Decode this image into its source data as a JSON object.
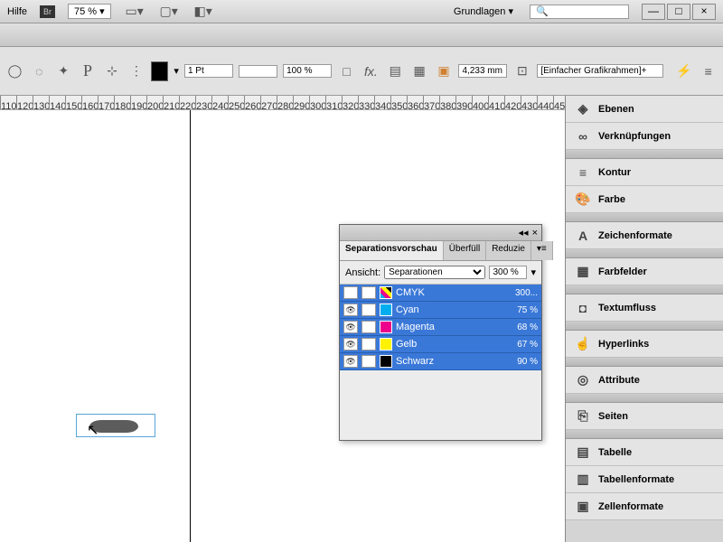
{
  "menubar": {
    "help": "Hilfe",
    "zoom": "75 %",
    "workspace": "Grundlagen",
    "search_placeholder": "🔍"
  },
  "controlbar": {
    "stroke": "1 Pt",
    "opacity": "100 %",
    "width": "4,233 mm",
    "frame_type": "[Einfacher Grafikrahmen]+"
  },
  "ruler_start": 110,
  "ruler_step": 10,
  "ruler_count": 35,
  "panels": [
    {
      "label": "Ebenen",
      "icon": "◈",
      "bold": true
    },
    {
      "label": "Verknüpfungen",
      "icon": "∞",
      "bold": true
    },
    {
      "divider": true
    },
    {
      "label": "Kontur",
      "icon": "≡",
      "bold": true
    },
    {
      "label": "Farbe",
      "icon": "🎨",
      "bold": true
    },
    {
      "divider": true
    },
    {
      "label": "Zeichenformate",
      "icon": "A",
      "bold": true
    },
    {
      "divider": true
    },
    {
      "label": "Farbfelder",
      "icon": "▦",
      "bold": true
    },
    {
      "divider": true
    },
    {
      "label": "Textumfluss",
      "icon": "◘",
      "bold": true
    },
    {
      "divider": true
    },
    {
      "label": "Hyperlinks",
      "icon": "☝",
      "bold": true
    },
    {
      "divider": true
    },
    {
      "label": "Attribute",
      "icon": "◎",
      "bold": true
    },
    {
      "divider": true
    },
    {
      "label": "Seiten",
      "icon": "⎘",
      "bold": true
    },
    {
      "divider": true
    },
    {
      "label": "Tabelle",
      "icon": "▤",
      "bold": true
    },
    {
      "label": "Tabellenformate",
      "icon": "▥",
      "bold": true
    },
    {
      "label": "Zellenformate",
      "icon": "▣",
      "bold": true
    }
  ],
  "sep_panel": {
    "tabs": [
      "Separationsvorschau",
      "Überfüll",
      "Reduzie"
    ],
    "ansicht_label": "Ansicht:",
    "ansicht_value": "Separationen",
    "limit": "300 %",
    "rows": [
      {
        "name": "CMYK",
        "value": "300...",
        "color": "linear-gradient(45deg,#00aeef 25%,#ec008c 25% 50%,#fff200 50% 75%,#000 75%)",
        "eye": false
      },
      {
        "name": "Cyan",
        "value": "75 %",
        "color": "#00aeef",
        "eye": true
      },
      {
        "name": "Magenta",
        "value": "68 %",
        "color": "#ec008c",
        "eye": true
      },
      {
        "name": "Gelb",
        "value": "67 %",
        "color": "#fff200",
        "eye": true
      },
      {
        "name": "Schwarz",
        "value": "90 %",
        "color": "#000000",
        "eye": true
      }
    ]
  }
}
